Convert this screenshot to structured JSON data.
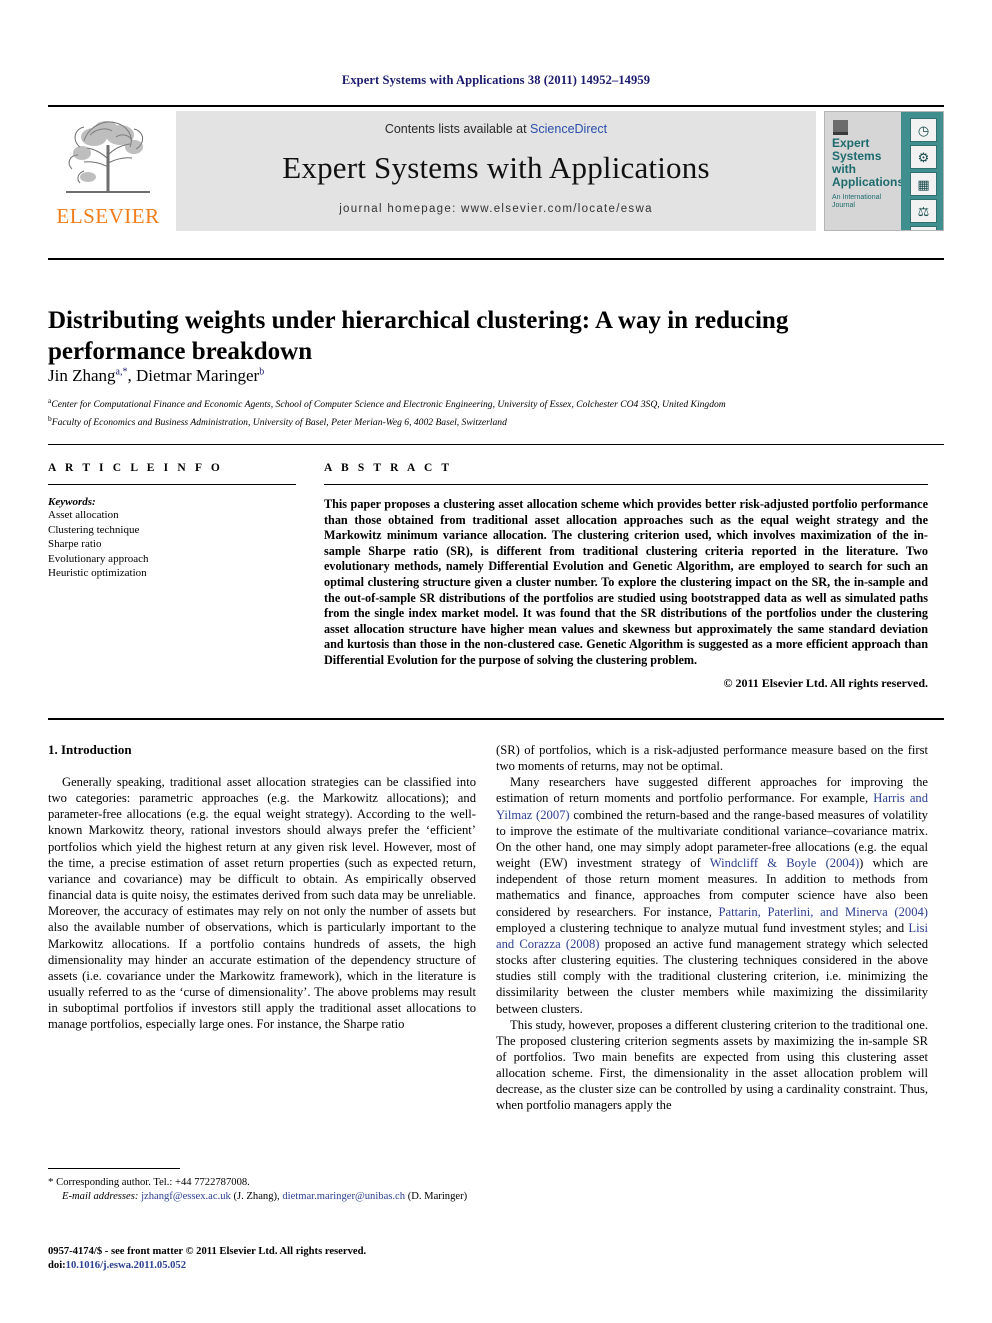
{
  "running_head": "Expert Systems with Applications 38 (2011) 14952–14959",
  "masthead": {
    "contents_prefix": "Contents lists available at ",
    "sciencedirect": "ScienceDirect",
    "journal_title": "Expert Systems with Applications",
    "homepage": "journal homepage: www.elsevier.com/locate/eswa",
    "publisher_name": "ELSEVIER",
    "publisher_color": "#f07d1a",
    "cover": {
      "title": "Expert Systems with Applications",
      "subtitle": "An International Journal",
      "strip_color": "#3f8f8f",
      "icons": [
        "clock-icon",
        "gear-icon",
        "bar-chart-icon",
        "scales-icon",
        "microscope-icon",
        "handshake-icon",
        "flask-icon",
        "pen-icon"
      ]
    }
  },
  "article": {
    "title": "Distributing weights under hierarchical clustering: A way in reducing performance breakdown",
    "authors": [
      {
        "name": "Jin Zhang",
        "marks": "a,*"
      },
      {
        "name": "Dietmar Maringer",
        "marks": "b"
      }
    ],
    "affiliations": [
      {
        "mark": "a",
        "text": "Center for Computational Finance and Economic Agents, School of Computer Science and Electronic Engineering, University of Essex, Colchester CO4 3SQ, United Kingdom"
      },
      {
        "mark": "b",
        "text": "Faculty of Economics and Business Administration, University of Basel, Peter Merian-Weg 6, 4002 Basel, Switzerland"
      }
    ]
  },
  "article_info": {
    "label": "A R T I C L E   I N F O",
    "keywords_label": "Keywords:",
    "keywords": [
      "Asset allocation",
      "Clustering technique",
      "Sharpe ratio",
      "Evolutionary approach",
      "Heuristic optimization"
    ]
  },
  "abstract": {
    "label": "A B S T R A C T",
    "text": "This paper proposes a clustering asset allocation scheme which provides better risk-adjusted portfolio performance than those obtained from traditional asset allocation approaches such as the equal weight strategy and the Markowitz minimum variance allocation. The clustering criterion used, which involves maximization of the in-sample Sharpe ratio (SR), is different from traditional clustering criteria reported in the literature. Two evolutionary methods, namely Differential Evolution and Genetic Algorithm, are employed to search for such an optimal clustering structure given a cluster number. To explore the clustering impact on the SR, the in-sample and the out-of-sample SR distributions of the portfolios are studied using bootstrapped data as well as simulated paths from the single index market model. It was found that the SR distributions of the portfolios under the clustering asset allocation structure have higher mean values and skewness but approximately the same standard deviation and kurtosis than those in the non-clustered case. Genetic Algorithm is suggested as a more efficient approach than Differential Evolution for the purpose of solving the clustering problem.",
    "copyright": "© 2011 Elsevier Ltd. All rights reserved."
  },
  "body": {
    "section_heading": "1. Introduction",
    "left_paragraphs": [
      "Generally speaking, traditional asset allocation strategies can be classified into two categories: parametric approaches (e.g. the Markowitz allocations); and parameter-free allocations (e.g. the equal weight strategy). According to the well-known Markowitz theory, rational investors should always prefer the ‘efficient’ portfolios which yield the highest return at any given risk level. However, most of the time, a precise estimation of asset return properties (such as expected return, variance and covariance) may be difficult to obtain. As empirically observed financial data is quite noisy, the estimates derived from such data may be unreliable. Moreover, the accuracy of estimates may rely on not only the number of assets but also the available number of observations, which is particularly important to the Markowitz allocations. If a portfolio contains hundreds of assets, the high dimensionality may hinder an accurate estimation of the dependency structure of assets (i.e. covariance under the Markowitz framework), which in the literature is usually referred to as the ‘curse of dimensionality’. The above problems may result in suboptimal portfolios if investors still apply the traditional asset allocations to manage portfolios, especially large ones. For instance, the Sharpe ratio"
    ],
    "right_paragraph_continuation": "(SR) of portfolios, which is a risk-adjusted performance measure based on the first two moments of returns, may not be optimal.",
    "right_paragraph_2_parts": [
      {
        "text": "Many researchers have suggested different approaches for improving the estimation of return moments and portfolio performance. For example, ",
        "cite": false
      },
      {
        "text": "Harris and Yilmaz (2007)",
        "cite": true
      },
      {
        "text": " combined the return-based and the range-based measures of volatility to improve the estimate of the multivariate conditional variance–covariance matrix. On the other hand, one may simply adopt parameter-free allocations (e.g. the equal weight (EW) investment strategy of ",
        "cite": false
      },
      {
        "text": "Windcliff & Boyle (2004)",
        "cite": true
      },
      {
        "text": ") which are independent of those return moment measures. In addition to methods from mathematics and finance, approaches from computer science have also been considered by researchers. For instance, ",
        "cite": false
      },
      {
        "text": "Pattarin, Paterlini, and Minerva (2004)",
        "cite": true
      },
      {
        "text": " employed a clustering technique to analyze mutual fund investment styles; and ",
        "cite": false
      },
      {
        "text": "Lisi and Corazza (2008)",
        "cite": true
      },
      {
        "text": " proposed an active fund management strategy which selected stocks after clustering equities. The clustering techniques considered in the above studies still comply with the traditional clustering criterion, i.e. minimizing the dissimilarity between the cluster members while maximizing the dissimilarity between clusters.",
        "cite": false
      }
    ],
    "right_paragraph_3": "This study, however, proposes a different clustering criterion to the traditional one. The proposed clustering criterion segments assets by maximizing the in-sample SR of portfolios. Two main benefits are expected from using this clustering asset allocation scheme. First, the dimensionality in the asset allocation problem will decrease, as the cluster size can be controlled by using a cardinality constraint. Thus, when portfolio managers apply the"
  },
  "footnotes": {
    "corresponding": "Corresponding author. Tel.: +44 7722787008.",
    "email_label": "E-mail addresses:",
    "emails": [
      {
        "address": "jzhangf@essex.ac.uk",
        "owner": "(J. Zhang)"
      },
      {
        "address": "dietmar.maringer@unibas.ch",
        "owner": "(D. Maringer)"
      }
    ],
    "front_matter": "0957-4174/$ - see front matter © 2011 Elsevier Ltd. All rights reserved.",
    "doi_label": "doi:",
    "doi_value": "10.1016/j.eswa.2011.05.052"
  }
}
